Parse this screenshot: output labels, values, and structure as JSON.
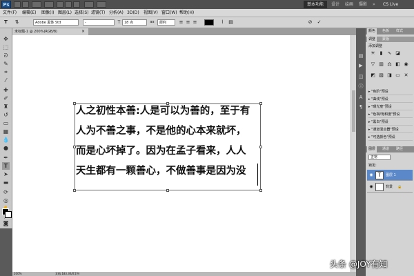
{
  "app": {
    "logo": "Ps",
    "window_ctrl_1": "",
    "workspace_button": "基本功能",
    "workspace_links": [
      "设计",
      "绘画",
      "摄影"
    ],
    "cs_live": "CS Live"
  },
  "menu": [
    "文件(F)",
    "编辑(E)",
    "图像(I)",
    "图层(L)",
    "选择(S)",
    "滤镜(T)",
    "分析(A)",
    "3D(D)",
    "视图(V)",
    "窗口(W)",
    "帮助(H)"
  ],
  "options": {
    "tool_icon": "T",
    "font_family": "Adobe 黑体 Std",
    "font_style": "-",
    "font_size": "18 点",
    "antialias_icon": "aa",
    "antialias": "犀利",
    "color": "#000000",
    "commit_icon": "✓",
    "cancel_icon": "⊘"
  },
  "document": {
    "tab_title": "未标题-1 @ 200%(RGB/8)",
    "tab_close": "×",
    "zoom": "200%",
    "doc_size": "文档:183.3K/0字节"
  },
  "text_lines": [
    "人之初性本善:人是可以为善的，至于有",
    "人为不善之事，不是他的心本来就坏，",
    "而是心坏掉了。因为在孟子看来，人人",
    "天生都有一颗善心，不做善事是因为没"
  ],
  "panel": {
    "top_tabs": [
      "颜色",
      "色板",
      "样式"
    ],
    "adj_tabs": [
      "调整",
      "蒙版"
    ],
    "adj_title": "添加调整",
    "presets": [
      "\"色阶\"预设",
      "\"曲线\"预设",
      "\"曝光度\"预设",
      "\"色相/饱和度\"预设",
      "\"黑白\"预设",
      "\"通道混合器\"预设",
      "\"可选颜色\"预设"
    ],
    "layer_tabs": [
      "图层",
      "通道",
      "路径"
    ],
    "blend_mode": "正常",
    "lock_label": "锁定:",
    "layers": [
      {
        "thumb": "T",
        "name": "图层 1"
      },
      {
        "thumb": "",
        "name": "背景"
      }
    ]
  },
  "watermark": "头条 @JOY有知"
}
